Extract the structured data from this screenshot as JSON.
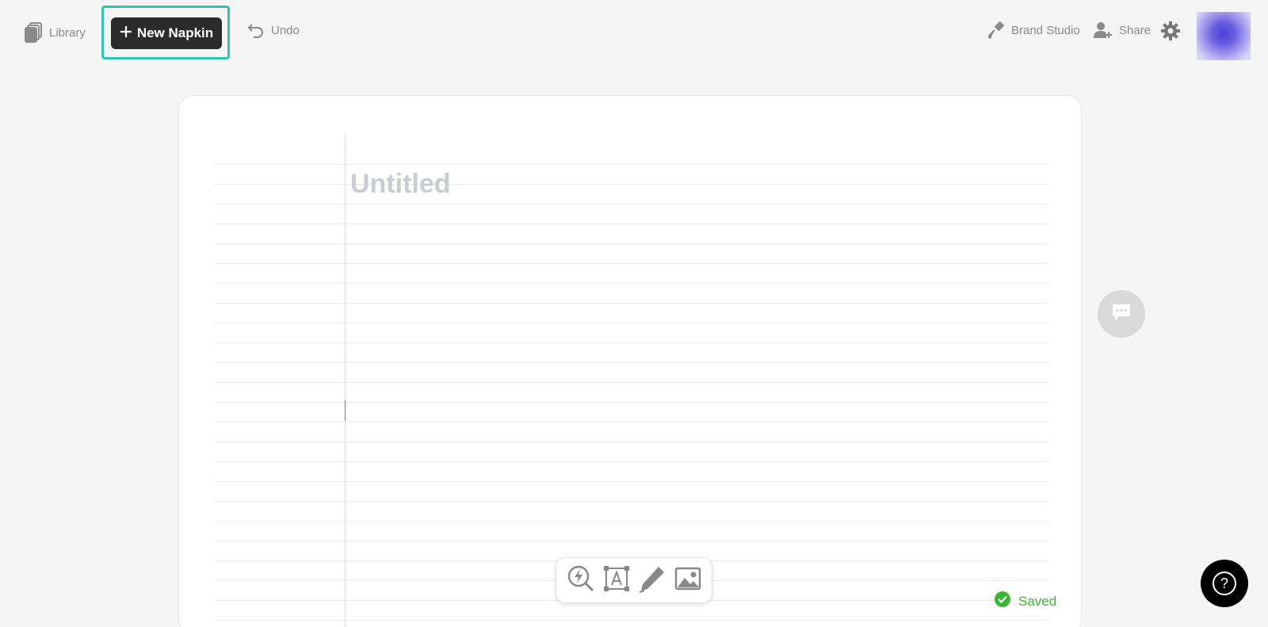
{
  "topbar": {
    "library_label": "Library",
    "new_napkin_label": "New Napkin",
    "undo_label": "Undo",
    "brand_studio_label": "Brand Studio",
    "share_label": "Share",
    "settings_icon": "gear-icon",
    "avatar": "user-avatar"
  },
  "document": {
    "title_placeholder": "Untitled"
  },
  "toolbar": {
    "tools": [
      "spark-search-icon",
      "text-box-icon",
      "pencil-icon",
      "image-icon"
    ]
  },
  "status": {
    "saved_label": "Saved",
    "saved_color": "#3cb534"
  },
  "colors": {
    "highlight": "#2ec4ae",
    "primary_button": "#2b2b2b"
  }
}
